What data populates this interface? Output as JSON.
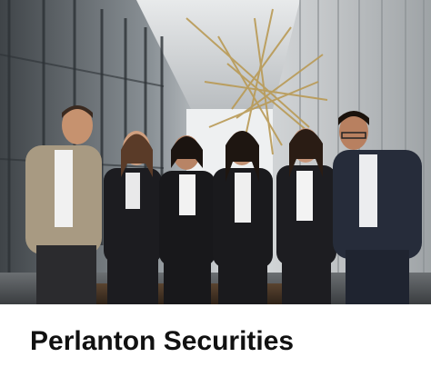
{
  "card": {
    "title": "Perlanton Securities"
  },
  "photo": {
    "subject": "team-photo",
    "people": [
      {
        "role": "man",
        "suit": "beige"
      },
      {
        "role": "woman",
        "suit": "black"
      },
      {
        "role": "woman",
        "suit": "black"
      },
      {
        "role": "woman",
        "suit": "black"
      },
      {
        "role": "woman",
        "suit": "black"
      },
      {
        "role": "man",
        "suit": "navy"
      }
    ]
  },
  "colors": {
    "text": "#111111",
    "background": "#ffffff"
  }
}
